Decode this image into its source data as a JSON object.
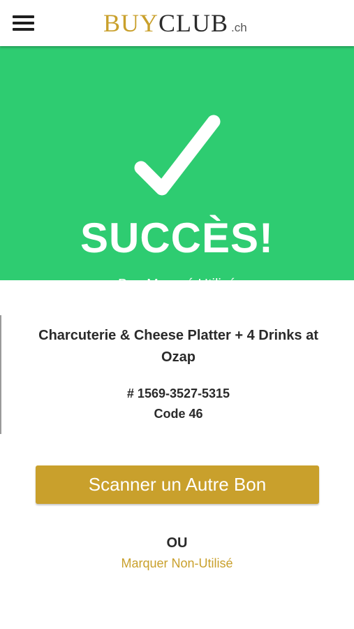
{
  "header": {
    "menu_icon": "hamburger-menu-icon",
    "logo_part1": "BUY",
    "logo_part2": "CLUB",
    "logo_suffix": ".ch"
  },
  "status": {
    "icon": "checkmark-icon",
    "title": "SUCCÈS!",
    "subtitle": "Bon Marqué Utilisé"
  },
  "voucher": {
    "deal_title": "Charcuterie & Cheese Platter + 4 Drinks at Ozap",
    "number": "# 1569-3527-5315",
    "code": "Code 46"
  },
  "actions": {
    "scan_button_label": "Scanner un Autre Bon",
    "or_label": "OU",
    "mark_unused_label": "Marquer Non-Utilisé"
  },
  "colors": {
    "brand_gold": "#c9a02c",
    "success_green": "#2ecc71",
    "text_dark": "#2a2a2a"
  }
}
